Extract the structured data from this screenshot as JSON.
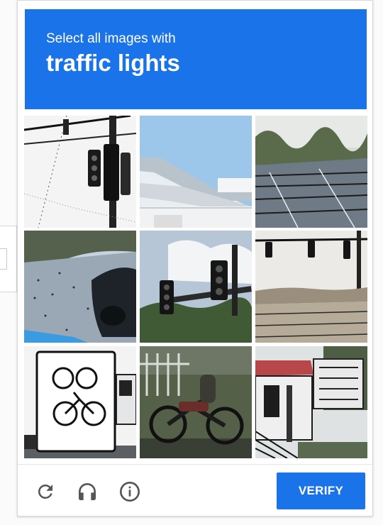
{
  "header": {
    "instruction": "Select all images with",
    "target": "traffic lights",
    "bg_color": "#1a73e8"
  },
  "tiles": [
    {
      "subject": "traffic light on pole against white sky"
    },
    {
      "subject": "house roof against blue sky"
    },
    {
      "subject": "road with bushes"
    },
    {
      "subject": "street with car"
    },
    {
      "subject": "traffic light over street with trees"
    },
    {
      "subject": "traffic lights over road"
    },
    {
      "subject": "vehicle with bicycle"
    },
    {
      "subject": "motorcycle near fence"
    },
    {
      "subject": "house with porch"
    }
  ],
  "footer": {
    "reload_icon": "reload-icon",
    "audio_icon": "headphones-icon",
    "info_icon": "info-icon",
    "verify_label": "VERIFY",
    "icon_color": "#555555"
  }
}
